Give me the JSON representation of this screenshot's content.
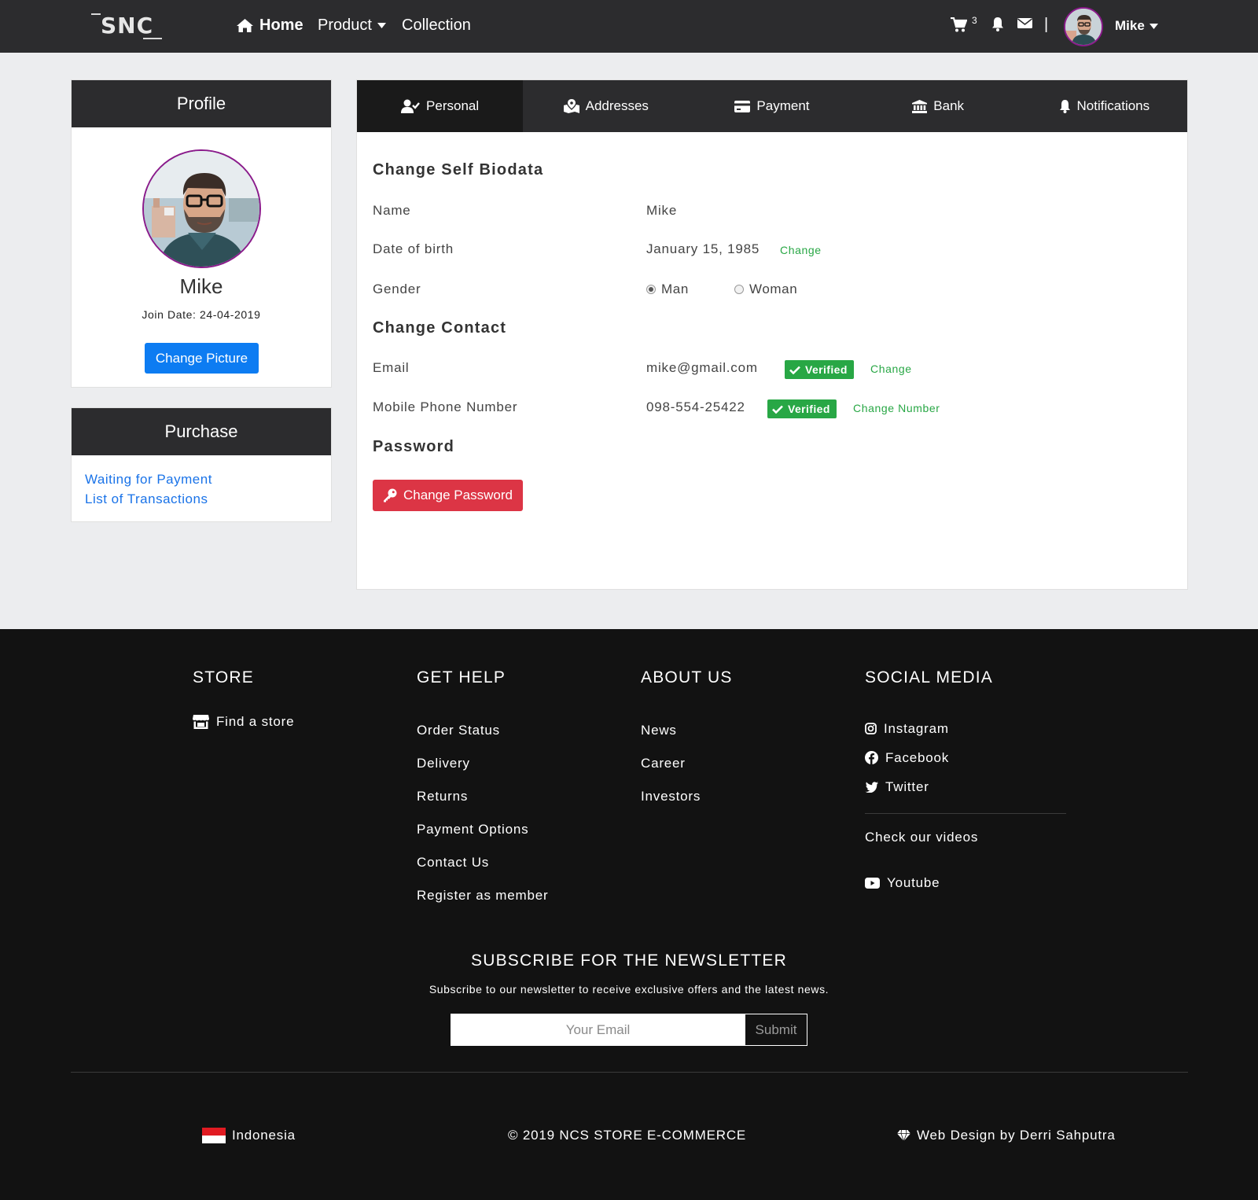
{
  "nav": {
    "logo": "SNC",
    "home": "Home",
    "product": "Product",
    "collection": "Collection",
    "cart_count": "3",
    "separator": "|",
    "user": "Mike",
    "icons": [
      "home-icon",
      "caret-down-icon",
      "cart-icon",
      "bell-icon",
      "envelope-icon"
    ]
  },
  "profile": {
    "title": "Profile",
    "name": "Mike",
    "join_date": "Join Date: 24-04-2019",
    "change_picture": "Change Picture"
  },
  "purchase": {
    "title": "Purchase",
    "links": [
      "Waiting for Payment",
      "List of Transactions"
    ]
  },
  "tabs": [
    {
      "label": "Personal",
      "icon": "user-check-icon",
      "active": true
    },
    {
      "label": "Addresses",
      "icon": "map-marked-icon",
      "active": false
    },
    {
      "label": "Payment",
      "icon": "credit-card-icon",
      "active": false
    },
    {
      "label": "Bank",
      "icon": "bank-icon",
      "active": false
    },
    {
      "label": "Notifications",
      "icon": "bell-icon",
      "active": false
    }
  ],
  "biodata": {
    "title": "Change Self Biodata",
    "name_label": "Name",
    "name_value": "Mike",
    "dob_label": "Date of birth",
    "dob_value": "January 15, 1985",
    "dob_change": "Change",
    "gender_label": "Gender",
    "gender_options": [
      "Man",
      "Woman"
    ],
    "gender_selected": "Man"
  },
  "contact": {
    "title": "Change Contact",
    "email_label": "Email",
    "email_value": "mike@gmail.com",
    "email_badge": "Verified",
    "email_change": "Change",
    "phone_label": "Mobile Phone Number",
    "phone_value": "098-554-25422",
    "phone_badge": "Verified",
    "phone_change": "Change Number"
  },
  "password": {
    "title": "Password",
    "button": "Change Password"
  },
  "footer": {
    "store": {
      "title": "STORE",
      "links": [
        "Find a store"
      ]
    },
    "get_help": {
      "title": "GET HELP",
      "links": [
        "Order Status",
        "Delivery",
        "Returns",
        "Payment Options",
        "Contact Us",
        "Register as member"
      ]
    },
    "about_us": {
      "title": "ABOUT US",
      "links": [
        "News",
        "Career",
        "Investors"
      ]
    },
    "social_media": {
      "title": "SOCIAL MEDIA",
      "links": [
        "Instagram",
        "Facebook",
        "Twitter"
      ],
      "videos_heading": "Check our videos",
      "youtube": "Youtube"
    },
    "newsletter": {
      "title": "SUBSCRIBE FOR THE NEWSLETTER",
      "subtitle": "Subscribe to our newsletter to receive exclusive offers and the latest news.",
      "placeholder": "Your Email",
      "submit": "Submit"
    },
    "country": "Indonesia",
    "copyright": "© 2019 NCS STORE E-COMMERCE",
    "credit": "Web Design by Derri Sahputra"
  },
  "colors": {
    "nav_bg": "#2c2c2e",
    "page_bg": "#ecedef",
    "footer_bg": "#121212",
    "primary": "#0d7cf2",
    "success": "#28a745",
    "danger": "#dc3545",
    "avatar_border": "#8b1a8b"
  }
}
